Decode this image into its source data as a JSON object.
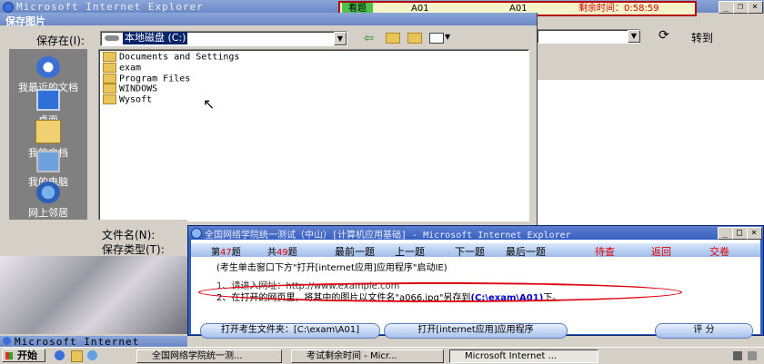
{
  "ie_window": {
    "title": "Microsoft Internet Explorer"
  },
  "exam_status": {
    "status": "看题",
    "id_a": "A01",
    "id_b": "A01",
    "remaining": "剩余时间：0:58:59"
  },
  "save_dialog": {
    "title": "保存图片",
    "save_in_label": "保存在(I):",
    "location": "本地磁盘 (C:)",
    "places": [
      {
        "label": "我最近的文档",
        "icon": "recent-documents-icon"
      },
      {
        "label": "桌面",
        "icon": "desktop-icon"
      },
      {
        "label": "我的文档",
        "icon": "my-documents-icon"
      },
      {
        "label": "我的电脑",
        "icon": "my-computer-icon"
      },
      {
        "label": "网上邻居",
        "icon": "network-places-icon"
      }
    ],
    "files": [
      "Documents and Settings",
      "exam",
      "Program Files",
      "WINDOWS",
      "Wysoft"
    ],
    "filename_label": "文件名(N):",
    "filetype_label": "保存类型(T):"
  },
  "ie_toolbar": {
    "goto_label": "转到"
  },
  "exam_window": {
    "title": "全国网络学院统一测试（中山）[计算机应用基础] - Microsoft Internet Explorer",
    "question_num_prefix": "第",
    "question_num": "47",
    "question_num_suffix": "题",
    "total_prefix": "共",
    "total": "49",
    "total_suffix": "题",
    "nav": {
      "first": "最前一题",
      "prev": "上一题",
      "next": "下一题",
      "last": "最后一题",
      "pending": "待查",
      "back": "返回",
      "submit": "交卷"
    },
    "instruction": "(考生单击窗口下方\"打开[internet应用]应用程序\"启动IE)",
    "step1": "1、请进入网址：http://www.example.com",
    "step2_prefix": "2、在打开的网页里，将其中的图片以文件名\"a066.jpg\"另存到",
    "step2_path": "(C:\\exam\\A01)",
    "step2_suffix": "下。",
    "open_folder_button": "打开考生文件夹：[C:\\exam\\A01]",
    "open_app_button": "打开[internet应用]应用程序",
    "grade_button": "评 分"
  },
  "background_window": {
    "title": "Microsoft Internet Explor"
  },
  "taskbar": {
    "start": "开始",
    "items": [
      "全国网络学院统一测...",
      "考试剩余时间 - Micr...",
      "Microsoft Internet ..."
    ]
  }
}
